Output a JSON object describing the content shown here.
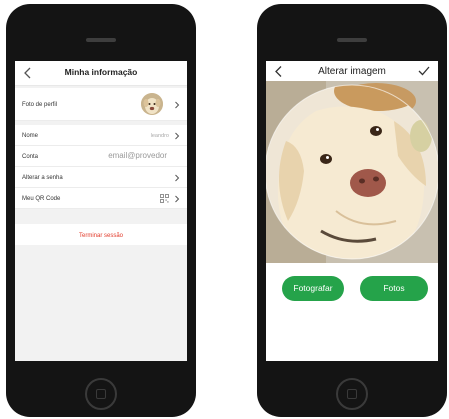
{
  "profile_screen": {
    "title": "Minha informação",
    "rows": [
      {
        "label": "Foto de perfil"
      },
      {
        "label": "Nome",
        "value": "leandro"
      },
      {
        "label": "Conta",
        "value": "email@provedor"
      },
      {
        "label": "Alterar a senha"
      },
      {
        "label": "Meu QR Code"
      }
    ],
    "logout_label": "Terminar sessão"
  },
  "image_screen": {
    "title": "Alterar imagem",
    "take_photo_label": "Fotografar",
    "photos_label": "Fotos"
  },
  "colors": {
    "accent_green": "#25a34a",
    "logout_red": "#e23a2a"
  }
}
